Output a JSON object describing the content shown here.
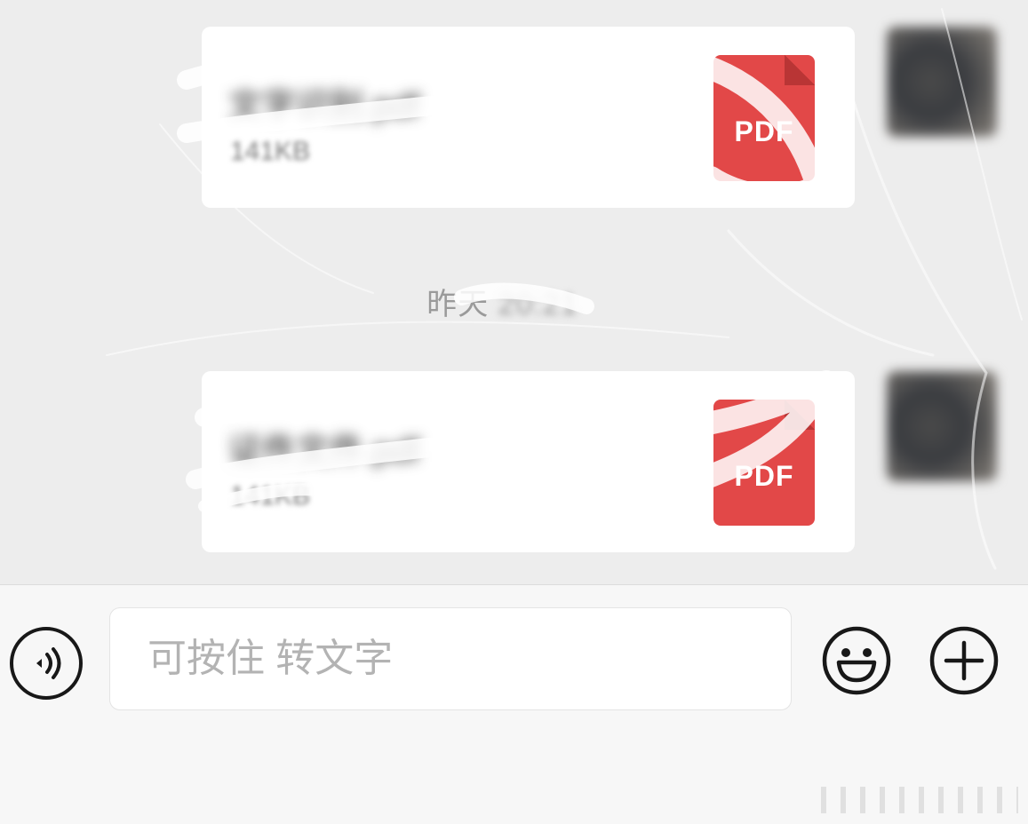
{
  "messages": [
    {
      "file_name": "文字识别.pdf",
      "file_size": "141KB",
      "file_type_label": "PDF"
    },
    {
      "file_name": "证件文件.pdf",
      "file_size": "141KB",
      "file_type_label": "PDF"
    }
  ],
  "timestamp": {
    "prefix": "昨天",
    "time": "20:21"
  },
  "input_bar": {
    "placeholder": "可按住 转文字",
    "value": ""
  },
  "icons": {
    "voice": "voice-icon",
    "emoji": "smiley-icon",
    "more": "plus-icon",
    "file": "pdf-file-icon"
  },
  "colors": {
    "pdf_red": "#e24848",
    "chat_background": "#ededed",
    "bubble": "#ffffff"
  }
}
